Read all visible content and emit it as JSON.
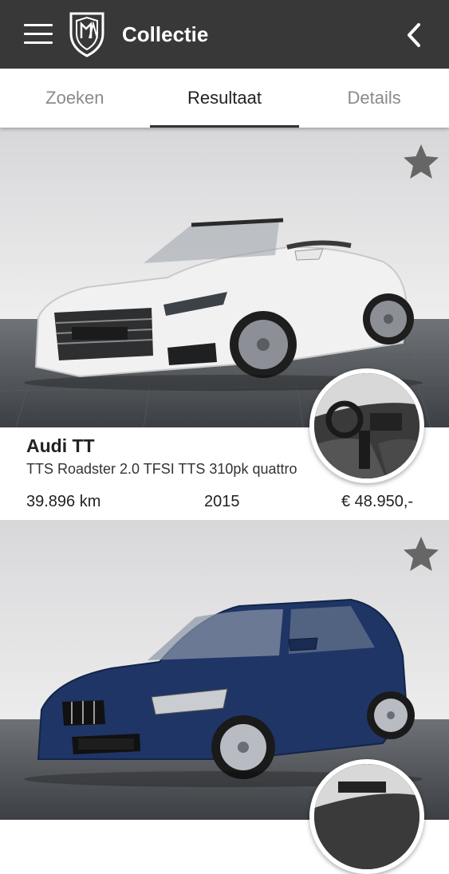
{
  "header": {
    "title": "Collectie",
    "background": "#383838",
    "menu_icon": "hamburger-menu-icon",
    "logo": "shield-logo",
    "back_icon": "chevron-left-icon"
  },
  "tabs": [
    {
      "label": "Zoeken",
      "active": false
    },
    {
      "label": "Resultaat",
      "active": true
    },
    {
      "label": "Details",
      "active": false
    }
  ],
  "results": [
    {
      "make": "Audi TT",
      "variant": "TTS Roadster 2.0 TFSI TTS 310pk quattro",
      "mileage": "39.896 km",
      "year": "2015",
      "price": "€ 48.950,-",
      "car_color": "#f3f3f3",
      "favorite_icon": "star-icon"
    },
    {
      "make": "",
      "variant": "",
      "mileage": "",
      "year": "",
      "price": "",
      "car_color": "#1f3566",
      "favorite_icon": "star-icon"
    }
  ]
}
